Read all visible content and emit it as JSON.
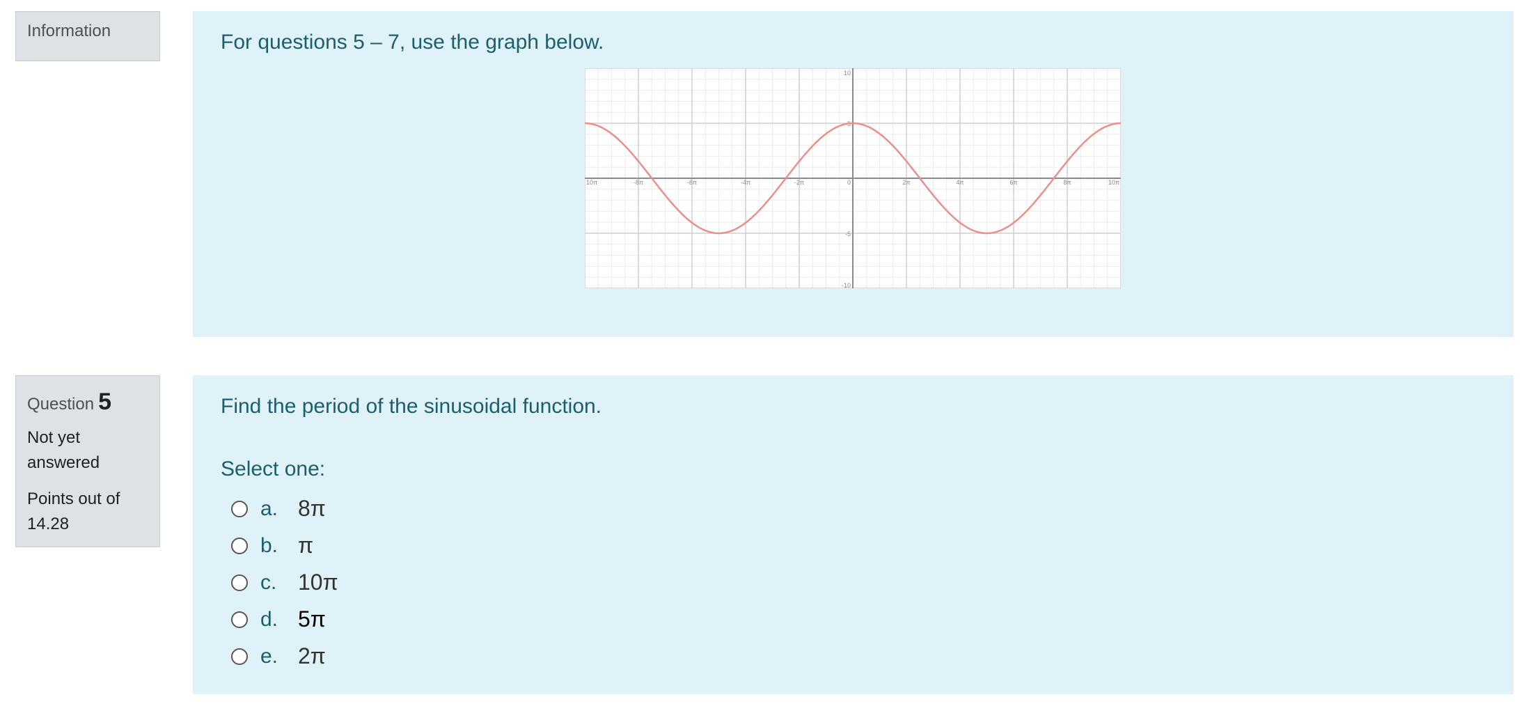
{
  "info": {
    "label": "Information",
    "text": "For questions 5 – 7, use the graph below."
  },
  "graph": {
    "x_tick_labels": [
      "10π",
      "-8π",
      "-6π",
      "-4π",
      "-2π",
      "0",
      "2π",
      "4π",
      "6π",
      "8π",
      "10π"
    ],
    "y_tick_labels": [
      "10",
      "5",
      "-5",
      "-10"
    ]
  },
  "chart_data": {
    "type": "line",
    "title": "",
    "xlabel": "",
    "ylabel": "",
    "xlim": [
      -10,
      10
    ],
    "ylim": [
      -10,
      10
    ],
    "x_unit": "π",
    "grid": true,
    "series": [
      {
        "color": "#e89089",
        "amplitude": 5,
        "period": 10,
        "x": [
          -10,
          -9,
          -8,
          -7,
          -6,
          -5,
          -4,
          -3,
          -2,
          -1,
          0,
          1,
          2,
          3,
          4,
          5,
          6,
          7,
          8,
          9,
          10
        ],
        "y": [
          5,
          4.05,
          1.55,
          -1.55,
          -4.05,
          -5,
          -4.05,
          -1.55,
          1.55,
          4.05,
          5,
          4.05,
          1.55,
          -1.55,
          -4.05,
          -5,
          -4.05,
          -1.55,
          1.55,
          4.05,
          5
        ]
      }
    ]
  },
  "question": {
    "label": "Question",
    "number": "5",
    "state_line1": "Not yet",
    "state_line2": "answered",
    "points_line1": "Points out of",
    "points_line2": "14.28",
    "text": "Find the period of the sinusoidal function.",
    "prompt": "Select one:",
    "options": [
      {
        "letter": "a.",
        "value": "8π"
      },
      {
        "letter": "b.",
        "value": "π"
      },
      {
        "letter": "c.",
        "value": "10π"
      },
      {
        "letter": "d.",
        "value": "5π"
      },
      {
        "letter": "e.",
        "value": "2π"
      }
    ]
  }
}
